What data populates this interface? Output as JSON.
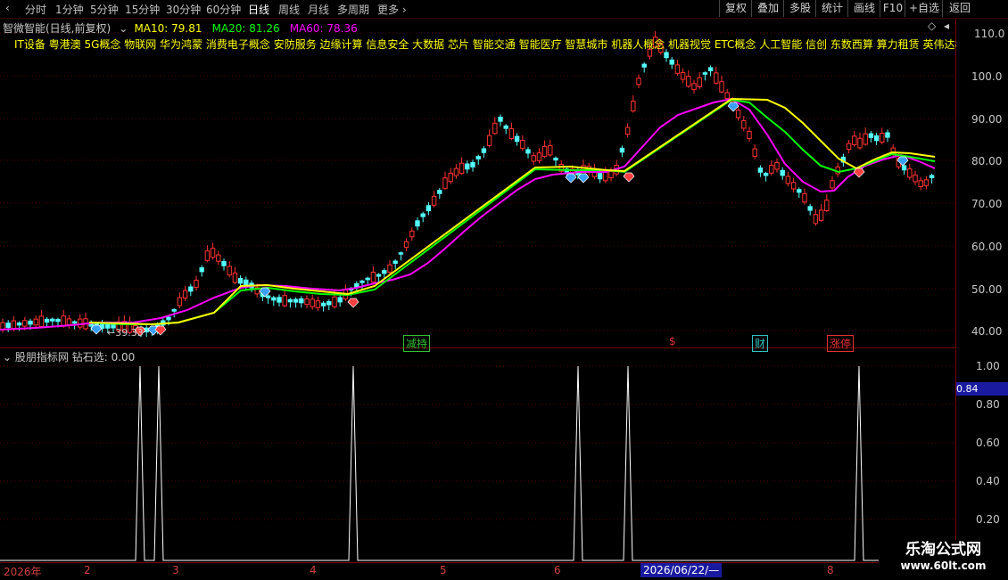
{
  "toolbar": {
    "tabs": [
      "分时",
      "1分钟",
      "5分钟",
      "15分钟",
      "30分钟",
      "60分钟",
      "日线",
      "周线",
      "月线",
      "多周期",
      "更多"
    ],
    "active": "日线",
    "right_buttons": [
      "复权",
      "叠加",
      "多股",
      "统计",
      "画线",
      "F10",
      "+自选",
      "返回"
    ]
  },
  "main": {
    "stock_title": "智微智能(日线,前复权)",
    "ma10_label": "MA10: 79.81",
    "ma20_label": "MA20: 81.26",
    "ma60_label": "MA60: 78.36",
    "concepts": "IT设备 粤港澳 5G概念 物联网 华为鸿蒙 消费电子概念 安防服务 边缘计算 信息安全 大数据 芯片 智能交通 智能医疗 智慧城市 机器人概念 机器视觉 ETC概念 人工智能 信创 东数西算 算力租赁 英伟达概念",
    "y_labels": [
      "110.0",
      "100.0",
      "90.00",
      "80.00",
      "70.00",
      "60.00",
      "50.00",
      "40.00"
    ],
    "low_marker": "←39.33",
    "badges": [
      {
        "text": "减持",
        "color": "#30c030"
      },
      {
        "text": "$",
        "color": "#e03030"
      },
      {
        "text": "财",
        "color": "#30c0c0"
      },
      {
        "text": "涨停",
        "color": "#e03030"
      }
    ],
    "colors": {
      "up": "#ff3232",
      "down": "#54ffff",
      "ma10": "#ffff00",
      "ma20": "#00ff00",
      "ma60": "#ff00ff"
    }
  },
  "indicator": {
    "title": "股朋指标网 钻石选: 0.00",
    "y_labels": [
      "1.00",
      "0.80",
      "0.60",
      "0.40",
      "0.20"
    ],
    "cursor_value": "0.84"
  },
  "datebar": {
    "labels": [
      "2026年",
      "2",
      "3",
      "4",
      "5",
      "6",
      "8"
    ],
    "highlight": "2026/06/22/—"
  },
  "watermark": {
    "title": "乐淘公式网",
    "url": "www.60lt.com"
  }
}
